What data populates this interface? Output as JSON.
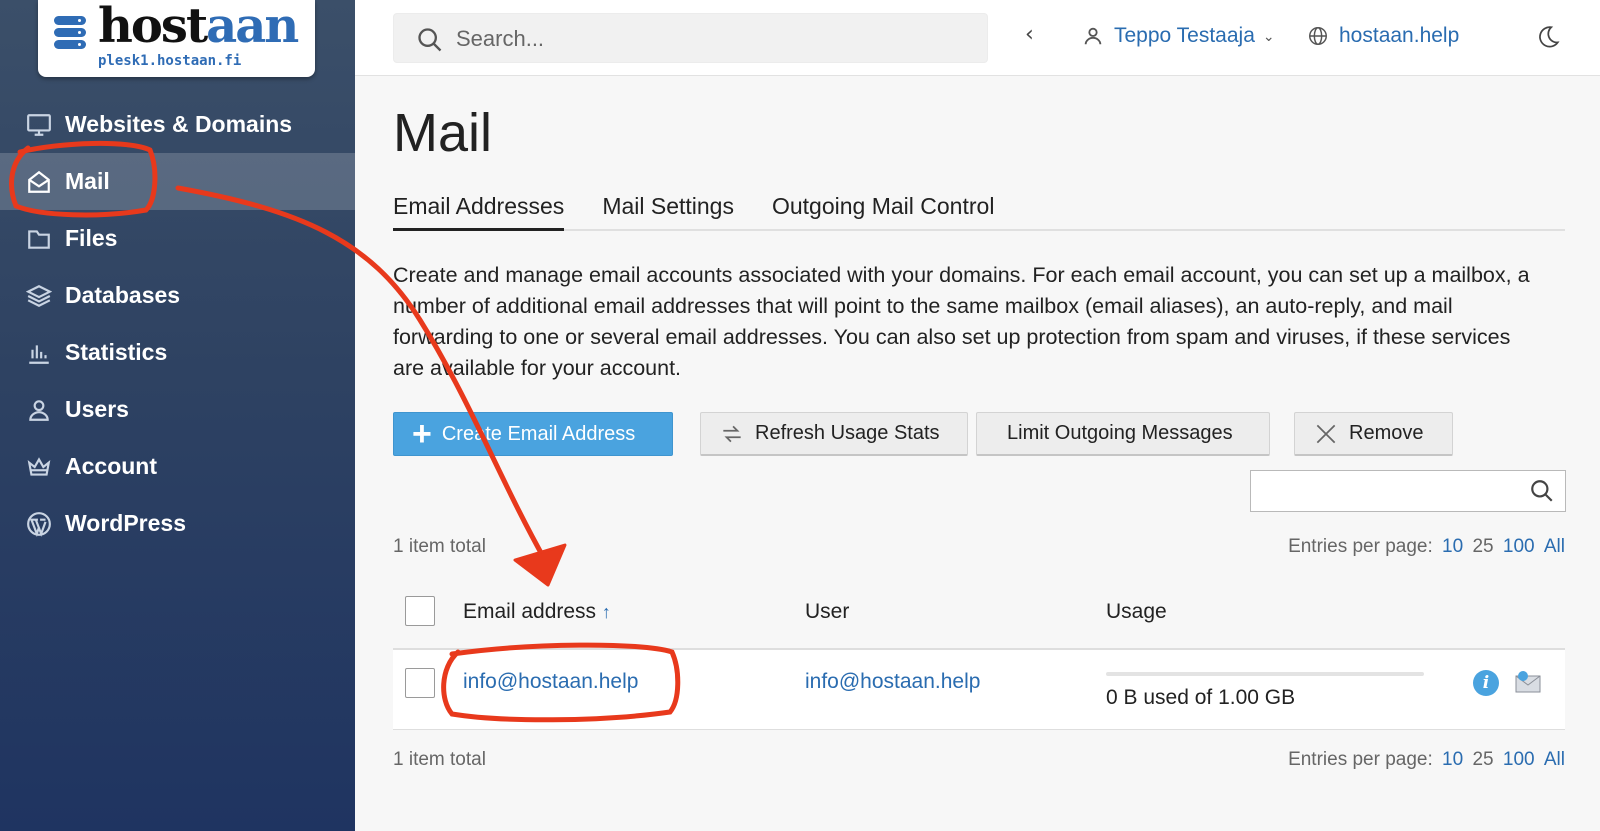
{
  "brand": {
    "name_part1": "host",
    "name_part2": "aan",
    "server": "plesk1.hostaan.fi",
    "accent": "#2f6cb5"
  },
  "sidebar": {
    "items": [
      {
        "label": "Websites & Domains",
        "icon": "monitor-icon"
      },
      {
        "label": "Mail",
        "icon": "mail-open-icon",
        "active": true
      },
      {
        "label": "Files",
        "icon": "folder-icon"
      },
      {
        "label": "Databases",
        "icon": "layers-icon"
      },
      {
        "label": "Statistics",
        "icon": "bar-chart-icon"
      },
      {
        "label": "Users",
        "icon": "user-icon"
      },
      {
        "label": "Account",
        "icon": "crown-icon"
      },
      {
        "label": "WordPress",
        "icon": "wordpress-icon"
      }
    ]
  },
  "topbar": {
    "search_placeholder": "Search...",
    "user_name": "Teppo Testaaja",
    "site": "hostaan.help"
  },
  "page": {
    "title": "Mail",
    "tabs": [
      "Email Addresses",
      "Mail Settings",
      "Outgoing Mail Control"
    ],
    "active_tab": "Email Addresses",
    "description": "Create and manage email accounts associated with your domains. For each email account, you can set up a mailbox, a number of additional email addresses that will point to the same mailbox (email aliases), an auto-reply, and mail forwarding to one or several email addresses. You can also set up protection from spam and viruses, if these services are available for your account."
  },
  "toolbar": {
    "create": "Create Email Address",
    "refresh": "Refresh Usage Stats",
    "limit": "Limit Outgoing Messages",
    "remove": "Remove"
  },
  "list": {
    "total_text": "1 item total",
    "entries_label": "Entries per page:",
    "entries_options": [
      "10",
      "25",
      "100",
      "All"
    ],
    "columns": {
      "email": "Email address",
      "sort_indicator": "↑",
      "user": "User",
      "usage": "Usage"
    },
    "rows": [
      {
        "email": "info@hostaan.help",
        "user": "info@hostaan.help",
        "usage": "0 B used of 1.00 GB",
        "usage_fraction": 0.0
      }
    ]
  },
  "colors": {
    "annotation": "#e8391c",
    "link": "#2a6cb0",
    "primary_button": "#4aa3df"
  }
}
